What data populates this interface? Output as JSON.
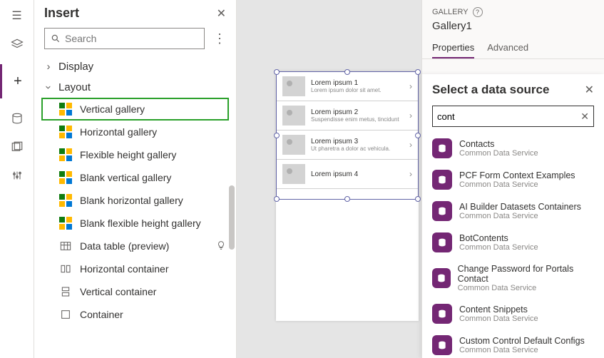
{
  "insert_panel": {
    "title": "Insert",
    "search_placeholder": "Search",
    "cat_display": "Display",
    "cat_layout": "Layout",
    "items": [
      "Vertical gallery",
      "Horizontal gallery",
      "Flexible height gallery",
      "Blank vertical gallery",
      "Blank horizontal gallery",
      "Blank flexible height gallery",
      "Data table (preview)",
      "Horizontal container",
      "Vertical container",
      "Container"
    ]
  },
  "gallery_preview": {
    "rows": [
      {
        "title": "Lorem ipsum 1",
        "sub": "Lorem ipsum dolor sit amet."
      },
      {
        "title": "Lorem ipsum 2",
        "sub": "Suspendisse enim metus, tincidunt"
      },
      {
        "title": "Lorem ipsum 3",
        "sub": "Ut pharetra a dolor ac vehicula."
      },
      {
        "title": "Lorem ipsum 4",
        "sub": ""
      }
    ]
  },
  "right_pane": {
    "section_label": "GALLERY",
    "control_name": "Gallery1",
    "tab_properties": "Properties",
    "tab_advanced": "Advanced"
  },
  "data_source_panel": {
    "title": "Select a data source",
    "search_value": "cont",
    "results": [
      {
        "name": "Contacts",
        "sub": "Common Data Service"
      },
      {
        "name": "PCF Form Context Examples",
        "sub": "Common Data Service"
      },
      {
        "name": "AI Builder Datasets Containers",
        "sub": "Common Data Service"
      },
      {
        "name": "BotContents",
        "sub": "Common Data Service"
      },
      {
        "name": "Change Password for Portals Contact",
        "sub": "Common Data Service"
      },
      {
        "name": "Content Snippets",
        "sub": "Common Data Service"
      },
      {
        "name": "Custom Control Default Configs",
        "sub": "Common Data Service"
      }
    ]
  }
}
